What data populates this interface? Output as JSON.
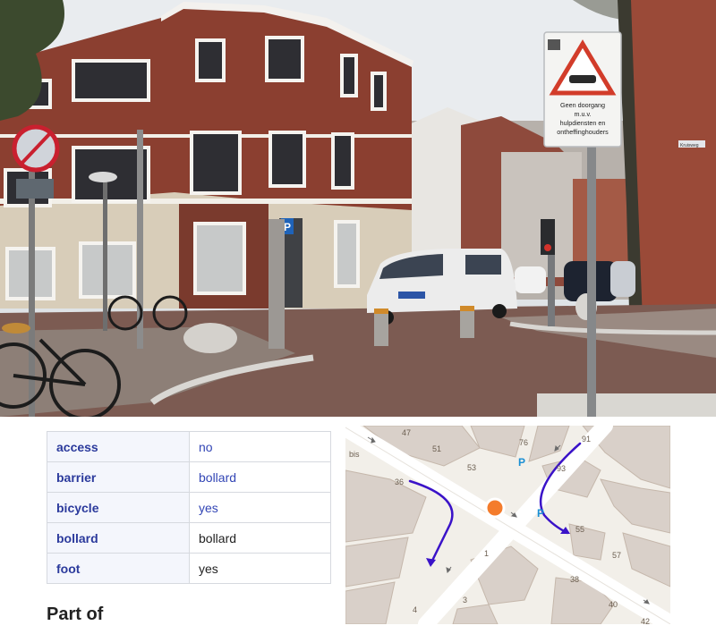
{
  "photo": {
    "sign_text": [
      "Geen doorgang",
      "m.u.v.",
      "hulpdiensten en",
      "ontheffinghouders"
    ],
    "street_sign_text": "Kruisweg",
    "parking_label": "P"
  },
  "tags": [
    {
      "key": "access",
      "value": "no",
      "value_is_link": true
    },
    {
      "key": "barrier",
      "value": "bollard",
      "value_is_link": true
    },
    {
      "key": "bicycle",
      "value": "yes",
      "value_is_link": true
    },
    {
      "key": "bollard",
      "value": "bollard",
      "value_is_link": false
    },
    {
      "key": "foot",
      "value": "yes",
      "value_is_link": false
    }
  ],
  "part_of_heading": "Part of",
  "map": {
    "house_numbers": [
      "47",
      "51",
      "76",
      "91",
      "53",
      "93",
      "bis",
      "36",
      "55",
      "57",
      "1",
      "38",
      "40",
      "42",
      "3",
      "4"
    ],
    "parking_labels": [
      "P",
      "P"
    ],
    "colors": {
      "marker": "#f47c2c",
      "arrow": "#3a12c8",
      "parking": "#1a8fd4",
      "building": "#d9d0c9",
      "road": "#ffffff"
    }
  }
}
